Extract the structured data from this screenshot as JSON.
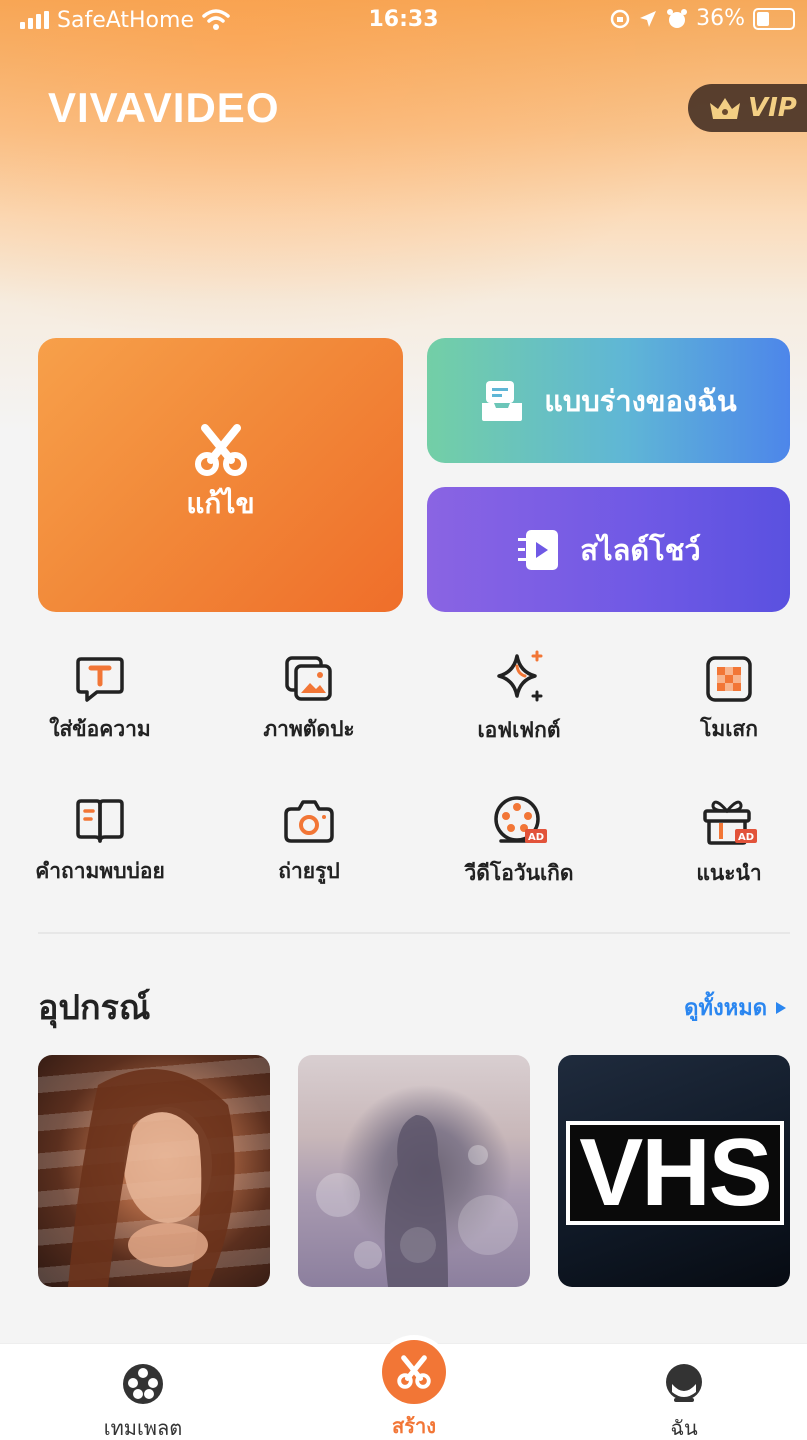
{
  "status_bar": {
    "carrier": "SafeAtHome",
    "time": "16:33",
    "battery": "36%",
    "battery_level": 0.36
  },
  "header": {
    "app_title": "VIVAVIDEO",
    "vip_label": "VIP"
  },
  "main_tiles": {
    "edit_label": "แก้ไข",
    "drafts_label": "แบบร่างของฉัน",
    "slideshow_label": "สไลด์โชว์"
  },
  "tools": [
    {
      "label": "ใส่ข้อความ",
      "icon": "text-icon"
    },
    {
      "label": "ภาพตัดปะ",
      "icon": "collage-icon"
    },
    {
      "label": "เอฟเฟกต์",
      "icon": "effects-sparkle-icon"
    },
    {
      "label": "โมเสก",
      "icon": "mosaic-icon"
    },
    {
      "label": "คำถามพบบ่อย",
      "icon": "faq-book-icon"
    },
    {
      "label": "ถ่ายรูป",
      "icon": "camera-icon"
    },
    {
      "label": "วีดีโอวันเกิด",
      "icon": "film-reel-ad-icon",
      "badge": "AD"
    },
    {
      "label": "แนะนำ",
      "icon": "gift-ad-icon",
      "badge": "AD"
    }
  ],
  "materials": {
    "title": "อุปกรณ์",
    "see_all": "ดูทั้งหมด",
    "thumbnails": [
      {
        "name": "portrait-blinds"
      },
      {
        "name": "girl-bokeh"
      },
      {
        "name": "vhs",
        "text": "VHS"
      }
    ]
  },
  "tabbar": {
    "templates": "เทมเพลต",
    "create": "สร้าง",
    "me": "ฉัน"
  },
  "colors": {
    "accent_orange": "#f27636",
    "link_blue": "#2a86f0",
    "vip_gold": "#f3cf84"
  }
}
